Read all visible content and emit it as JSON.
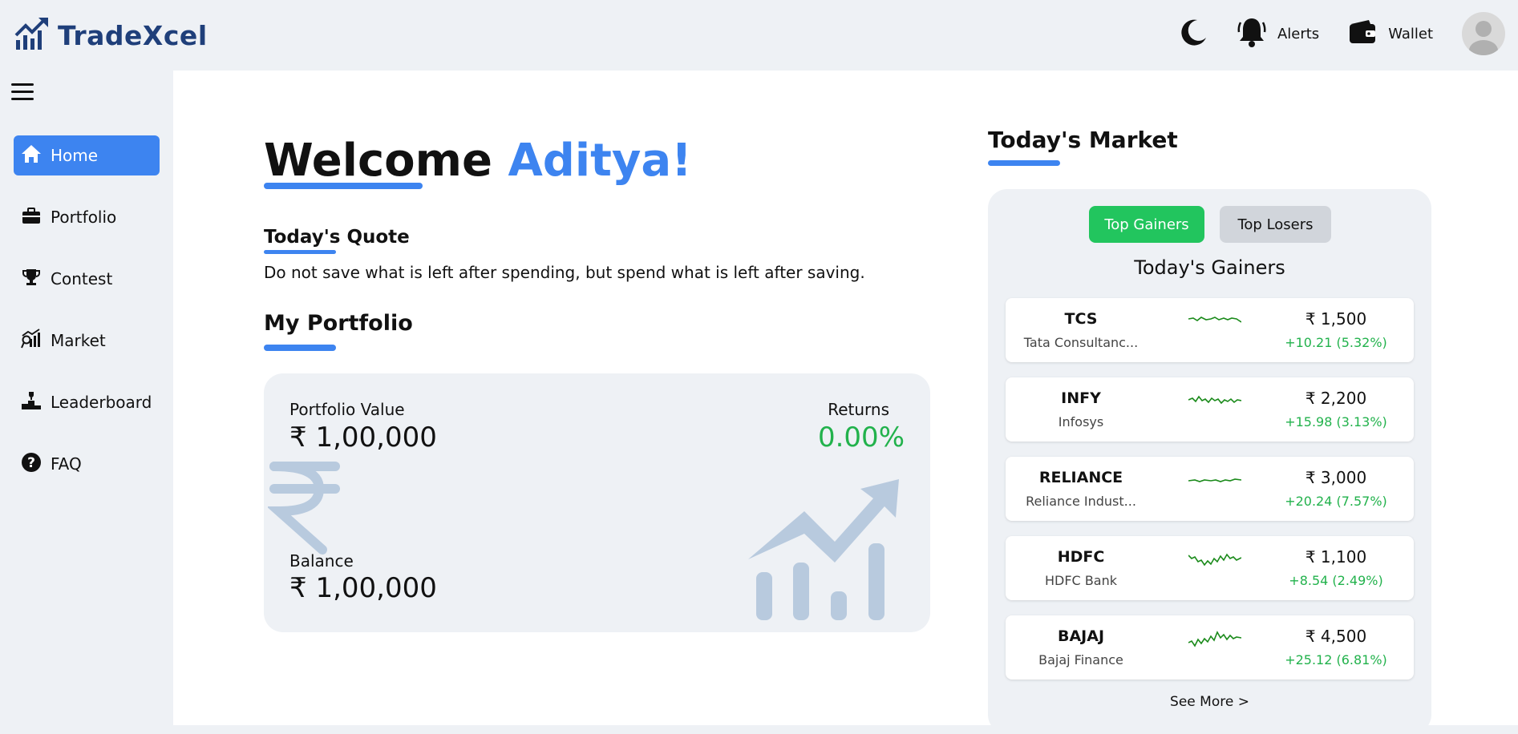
{
  "header": {
    "brand": "TradeXcel",
    "alerts_label": "Alerts",
    "wallet_label": "Wallet"
  },
  "sidebar": {
    "items": [
      {
        "label": "Home",
        "icon": "home-icon",
        "active": true
      },
      {
        "label": "Portfolio",
        "icon": "briefcase-icon"
      },
      {
        "label": "Contest",
        "icon": "trophy-icon"
      },
      {
        "label": "Market",
        "icon": "market-chart-icon"
      },
      {
        "label": "Leaderboard",
        "icon": "podium-icon"
      },
      {
        "label": "FAQ",
        "icon": "question-icon"
      }
    ]
  },
  "main": {
    "welcome_prefix": "Welcome ",
    "welcome_name": "Aditya!",
    "quote_title": "Today's Quote",
    "quote_text": "Do not save what is left after spending, but spend what is left after saving.",
    "portfolio_title": "My Portfolio",
    "portfolio": {
      "value_label": "Portfolio Value",
      "value": "₹ 1,00,000",
      "returns_label": "Returns",
      "returns": "0.00%",
      "balance_label": "Balance",
      "balance": "₹ 1,00,000"
    }
  },
  "market": {
    "title": "Today's Market",
    "tab_gainers": "Top Gainers",
    "tab_losers": "Top Losers",
    "list_title": "Today's Gainers",
    "stocks": [
      {
        "symbol": "TCS",
        "name": "Tata Consultanc...",
        "price": "₹ 1,500",
        "change": "+10.21 (5.32%)"
      },
      {
        "symbol": "INFY",
        "name": "Infosys",
        "price": "₹ 2,200",
        "change": "+15.98 (3.13%)"
      },
      {
        "symbol": "RELIANCE",
        "name": "Reliance Indust...",
        "price": "₹ 3,000",
        "change": "+20.24 (7.57%)"
      },
      {
        "symbol": "HDFC",
        "name": "HDFC Bank",
        "price": "₹ 1,100",
        "change": "+8.54 (2.49%)"
      },
      {
        "symbol": "BAJAJ",
        "name": "Bajaj Finance",
        "price": "₹ 4,500",
        "change": "+25.12 (6.81%)"
      }
    ],
    "see_more": "See More >"
  },
  "colors": {
    "accent": "#3d84f0",
    "brand": "#1f3f7a",
    "positive": "#22b24c",
    "gainers_tab": "#22c55e",
    "sparkline": "#1a8a1a"
  }
}
